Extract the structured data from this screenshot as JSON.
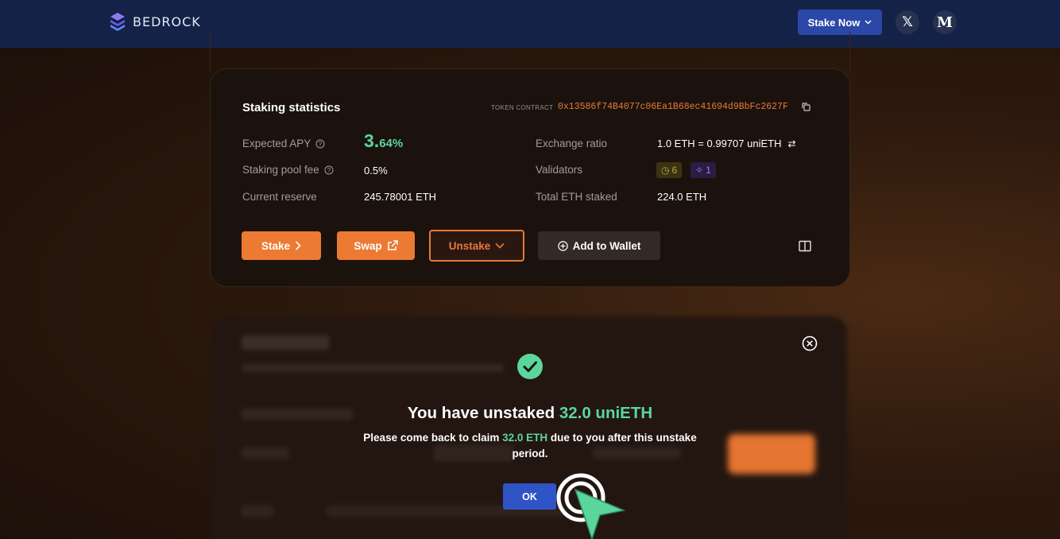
{
  "nav": {
    "brand": "BEDROCK",
    "stake_now_label": "Stake Now",
    "x_label": "𝕏",
    "medium_label": "M"
  },
  "stats": {
    "title": "Staking statistics",
    "token_contract_label": "TOKEN CONTRACT",
    "token_contract_address": "0x13586f74B4077c06Ea1B68ec41694d9BbFc2627F",
    "expected_apy_label": "Expected APY",
    "expected_apy_big": "3.",
    "expected_apy_small": "64%",
    "staking_pool_fee_label": "Staking pool fee",
    "staking_pool_fee_value": "0.5%",
    "current_reserve_label": "Current reserve",
    "current_reserve_value": "245.78001 ETH",
    "exchange_ratio_label": "Exchange ratio",
    "exchange_ratio_value": "1.0 ETH = 0.99707 uniETH",
    "validators_label": "Validators",
    "validators_active": "6",
    "validators_pending": "1",
    "total_staked_label": "Total ETH staked",
    "total_staked_value": "224.0 ETH"
  },
  "actions": {
    "stake_label": "Stake",
    "swap_label": "Swap",
    "unstake_label": "Unstake",
    "add_wallet_label": "Add to Wallet"
  },
  "modal": {
    "title_prefix": "You have unstaked ",
    "title_amount": "32.0 uniETH",
    "msg_prefix": "Please come back to claim ",
    "msg_amount": "32.0 ETH",
    "msg_suffix": " due to you after this unstake period.",
    "ok_label": "OK"
  },
  "colors": {
    "accent_orange": "#ec7a33",
    "accent_green": "#5ad69c",
    "nav_blue": "#142247",
    "button_blue": "#2b47a8"
  }
}
